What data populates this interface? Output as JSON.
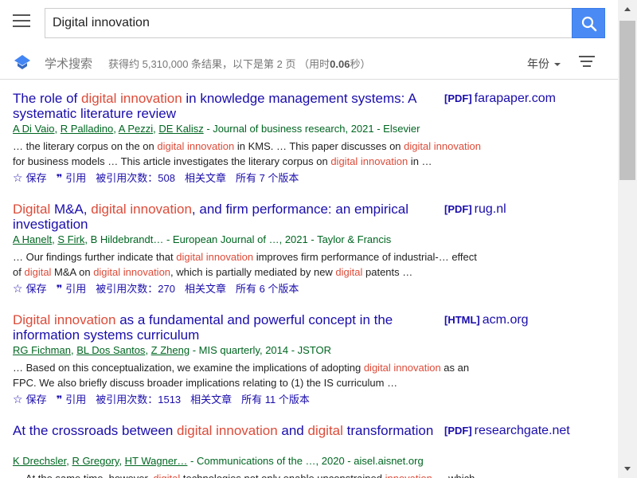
{
  "header": {
    "search_value": "Digital innovation",
    "brand": "学术搜索",
    "stats_prefix": "获得约 5,310,000 条结果，以下是第 2 页 （用时",
    "stats_time": "0.06",
    "stats_suffix": "秒）",
    "year_filter": "年份"
  },
  "results": [
    {
      "title": [
        [
          "The role of ",
          false
        ],
        [
          "digital innovation",
          true
        ],
        [
          " in knowledge management systems: A systematic literature review",
          false
        ]
      ],
      "file_type": "[PDF]",
      "source": "farapaper.com",
      "authors": [
        "A Di Vaio",
        "R Palladino",
        "A Pezzi",
        "DE Kalisz"
      ],
      "authors_plain_tail": "",
      "venue": " - Journal of business research, 2021 - Elsevier",
      "snippet": [
        [
          "… the literary corpus on the on ",
          false
        ],
        [
          "digital innovation",
          true
        ],
        [
          " in KMS. … This paper discusses on ",
          false
        ],
        [
          "digital innovation",
          true
        ],
        [
          " for business models … This article investigates the literary corpus on ",
          false
        ],
        [
          "digital innovation",
          true
        ],
        [
          " in …",
          false
        ]
      ],
      "save": "保存",
      "cite": "引用",
      "cited_by": "被引用次数：508",
      "related": "相关文章",
      "versions": "所有 7 个版本"
    },
    {
      "title": [
        [
          "Digital",
          true
        ],
        [
          " M&A, ",
          false
        ],
        [
          "digital innovation",
          true
        ],
        [
          ", and firm performance: an empirical investigation",
          false
        ]
      ],
      "file_type": "[PDF]",
      "source": "rug.nl",
      "authors": [
        "A Hanelt",
        "S Firk"
      ],
      "authors_plain_tail": "B Hildebrandt…",
      "venue": " - European Journal of …, 2021 - Taylor & Francis",
      "snippet": [
        [
          "… Our findings further indicate that ",
          false
        ],
        [
          "digital innovation",
          true
        ],
        [
          " improves firm performance of industrial-… effect of ",
          false
        ],
        [
          "digital",
          true
        ],
        [
          " M&A on ",
          false
        ],
        [
          "digital innovation",
          true
        ],
        [
          ", which is partially mediated by new ",
          false
        ],
        [
          "digital",
          true
        ],
        [
          " patents …",
          false
        ]
      ],
      "save": "保存",
      "cite": "引用",
      "cited_by": "被引用次数：270",
      "related": "相关文章",
      "versions": "所有 6 个版本"
    },
    {
      "title": [
        [
          "Digital innovation",
          true
        ],
        [
          " as a fundamental and powerful concept in the information systems curriculum",
          false
        ]
      ],
      "file_type": "[HTML]",
      "source": "acm.org",
      "authors": [
        "RG Fichman",
        "BL Dos Santos",
        "Z Zheng"
      ],
      "authors_plain_tail": "",
      "venue": " - MIS quarterly, 2014 - JSTOR",
      "snippet": [
        [
          "… Based on this conceptualization, we examine the implications of adopting ",
          false
        ],
        [
          "digital innovation",
          true
        ],
        [
          " as an FPC. We also briefly discuss broader implications relating to (1) the IS curriculum …",
          false
        ]
      ],
      "save": "保存",
      "cite": "引用",
      "cited_by": "被引用次数：1513",
      "related": "相关文章",
      "versions": "所有 11 个版本"
    },
    {
      "title": [
        [
          "At the crossroads between ",
          false
        ],
        [
          "digital innovation",
          true
        ],
        [
          " and ",
          false
        ],
        [
          "digital",
          true
        ],
        [
          " transformation",
          false
        ]
      ],
      "file_type": "[PDF]",
      "source": "researchgate.net",
      "authors": [
        "K Drechsler",
        "R Gregory",
        "HT Wagner…"
      ],
      "authors_plain_tail": "",
      "venue": " - Communications of the …, 2020 - aisel.aisnet.org",
      "snippet": [
        [
          "… At the same time, however, ",
          false
        ],
        [
          "digital",
          true
        ],
        [
          " technologies not only enable unconstrained ",
          false
        ],
        [
          "innovation",
          true
        ],
        [
          " … which",
          false
        ]
      ],
      "save": "",
      "cite": "",
      "cited_by": "",
      "related": "",
      "versions": ""
    }
  ]
}
